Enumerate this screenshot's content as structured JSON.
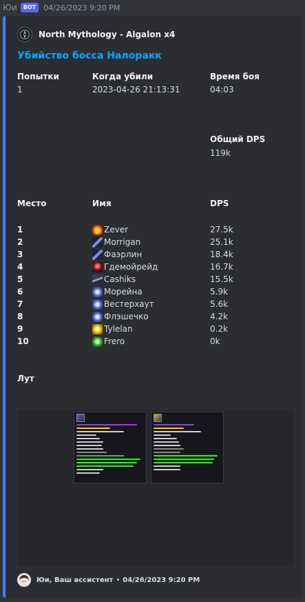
{
  "message": {
    "username": "Юи",
    "bot_badge": "BOT",
    "timestamp": "04/26/2023 9:20 PM"
  },
  "embed": {
    "accent_color": "#3b82f6",
    "author": {
      "name": "North Mythology - Algalon x4",
      "icon": "guild-emblem-icon"
    },
    "title": "Убийство босса Налоракк",
    "fields": {
      "attempts": {
        "name": "Попытки",
        "value": "1"
      },
      "killed_at": {
        "name": "Когда убили",
        "value": "2023-04-26 21:13:31"
      },
      "fight_time": {
        "name": "Время боя",
        "value": "04:03"
      },
      "total_dps": {
        "name": "Общий DPS",
        "value": "119k"
      }
    },
    "ranking": {
      "place_header": "Место",
      "name_header": "Имя",
      "dps_header": "DPS",
      "rows": [
        {
          "place": "1",
          "name": "Zever",
          "dps": "27.5k",
          "icon": "fire-mage-icon"
        },
        {
          "place": "2",
          "name": "Morrigan",
          "dps": "25.1k",
          "icon": "shadow-priest-icon"
        },
        {
          "place": "3",
          "name": "Фаэрлин",
          "dps": "18.4k",
          "icon": "shadow-priest-icon"
        },
        {
          "place": "4",
          "name": "Гдемойрейд",
          "dps": "16.7k",
          "icon": "warlock-icon"
        },
        {
          "place": "5",
          "name": "Cashiks",
          "dps": "15.5k",
          "icon": "rogue-icon"
        },
        {
          "place": "6",
          "name": "Морейна",
          "dps": "5.9k",
          "icon": "paladin-icon"
        },
        {
          "place": "7",
          "name": "Вестерхаут",
          "dps": "5.6k",
          "icon": "paladin-icon"
        },
        {
          "place": "8",
          "name": "Флэшечко",
          "dps": "4.2k",
          "icon": "paladin-icon"
        },
        {
          "place": "9",
          "name": "Tylelan",
          "dps": "0.2k",
          "icon": "holy-light-icon"
        },
        {
          "place": "10",
          "name": "Frero",
          "dps": "0k",
          "icon": "nature-icon"
        }
      ]
    },
    "loot": {
      "label": "Лут",
      "image": "loot-tooltips-image"
    },
    "footer": {
      "text": "Юи, Ваш ассистент",
      "separator": "•",
      "timestamp": "04/26/2023 9:20 PM"
    }
  }
}
